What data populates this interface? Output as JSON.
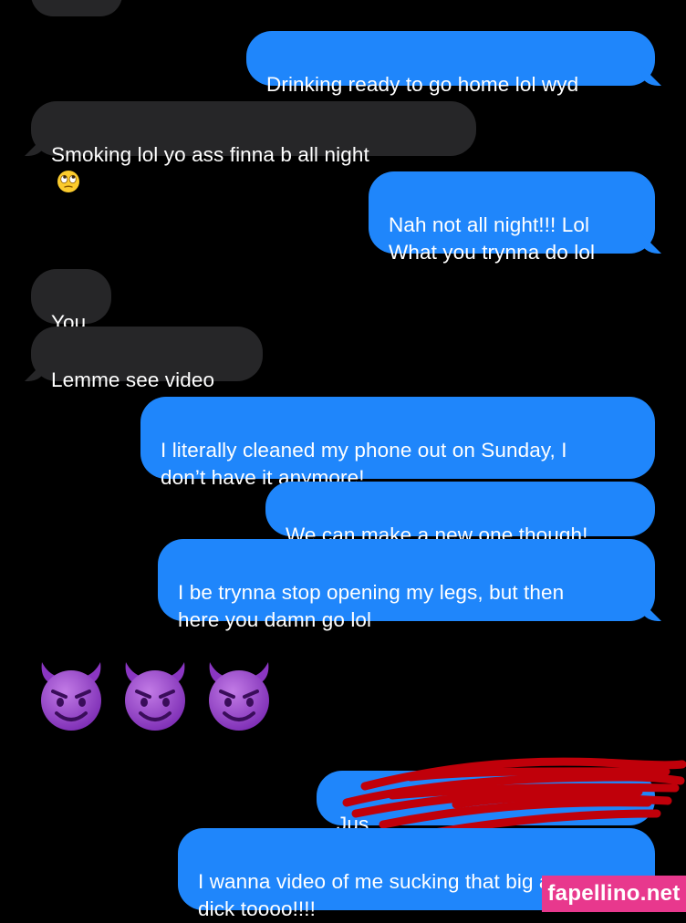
{
  "messages": [
    {
      "id": "m1",
      "side": "out",
      "text": "Drinking ready to go home lol wyd"
    },
    {
      "id": "m2",
      "side": "in",
      "text": "Smoking lol yo ass finna b all night",
      "emoji": "face-with-rolling-eyes"
    },
    {
      "id": "m3",
      "side": "out",
      "text": "Nah not all night!!! Lol\nWhat you trynna do lol"
    },
    {
      "id": "m4",
      "side": "in",
      "text": "You"
    },
    {
      "id": "m5",
      "side": "in",
      "text": "Lemme see video"
    },
    {
      "id": "m6",
      "side": "out",
      "text": "I literally cleaned my phone out on Sunday, I\ndon’t have it anymore!"
    },
    {
      "id": "m7",
      "side": "out",
      "text": "We can make a new one though!"
    },
    {
      "id": "m8",
      "side": "out",
      "text": "I be trynna stop opening my legs, but then\nhere you damn go lol"
    },
    {
      "id": "m9",
      "side": "in",
      "emoji": [
        "smiling-face-with-horns",
        "smiling-face-with-horns",
        "smiling-face-with-horns"
      ]
    },
    {
      "id": "m10",
      "side": "out",
      "text": "Jus",
      "redacted": true
    },
    {
      "id": "m11",
      "side": "out",
      "text": "I wanna video of me sucking that big ass\ndick toooo!!!!"
    }
  ],
  "watermark": "fapellino.net",
  "colors": {
    "background": "#000000",
    "outgoing": "#1f86fb",
    "incoming": "#262628",
    "watermark": "#e8388d",
    "redaction": "#c0000a"
  }
}
